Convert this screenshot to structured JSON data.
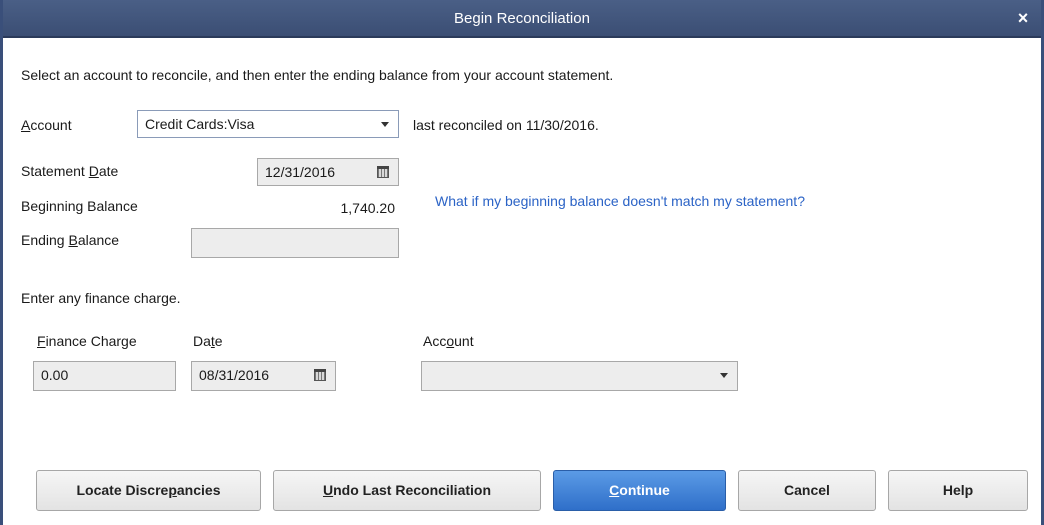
{
  "window": {
    "title": "Begin Reconciliation",
    "close_glyph": "×"
  },
  "intro": "Select an account to reconcile, and then enter the ending balance from your account statement.",
  "account": {
    "label_pre": "",
    "label_u": "A",
    "label_post": "ccount",
    "value": "Credit Cards:Visa",
    "last_reconciled": "last reconciled on 11/30/2016."
  },
  "statement_date": {
    "label_pre": "Statement ",
    "label_u": "D",
    "label_post": "ate",
    "value": "12/31/2016"
  },
  "beginning_balance": {
    "label": "Beginning Balance",
    "value": "1,740.20",
    "help_link": "What if my beginning balance doesn't match my statement?"
  },
  "ending_balance": {
    "label_pre": "Ending ",
    "label_u": "B",
    "label_post": "alance",
    "value": ""
  },
  "finance": {
    "heading": "Enter any finance charge.",
    "charge_label_pre": "",
    "charge_label_u": "F",
    "charge_label_post": "inance Charge",
    "charge_value": "0.00",
    "date_label_pre": "Da",
    "date_label_u": "t",
    "date_label_post": "e",
    "date_value": "08/31/2016",
    "account_label_pre": "Acc",
    "account_label_u": "o",
    "account_label_post": "unt",
    "account_value": ""
  },
  "buttons": {
    "locate_pre": "Locate Discre",
    "locate_u": "p",
    "locate_post": "ancies",
    "undo_pre": "",
    "undo_u": "U",
    "undo_post": "ndo Last Reconciliation",
    "continue_pre": "",
    "continue_u": "C",
    "continue_post": "ontinue",
    "cancel": "Cancel",
    "help": "Help"
  },
  "colors": {
    "titlebar": "#4a5f86",
    "link": "#2b63c6",
    "primary_button": "#2f6fc9"
  }
}
